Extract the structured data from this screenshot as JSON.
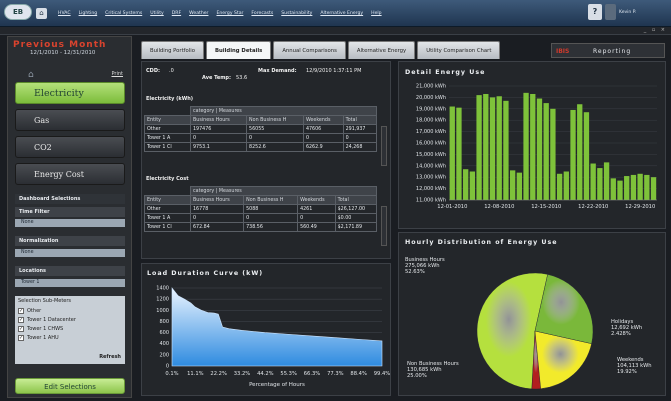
{
  "topbar": {
    "logo": "EB",
    "menu": [
      "HVAC",
      "Lighting",
      "Critical Systems",
      "Utility",
      "DRF",
      "Weather",
      "Energy Star",
      "Forecasts",
      "Sustainability",
      "Alternative Energy",
      "Help"
    ],
    "help_label": "?",
    "user_label": "Kevin P."
  },
  "window": {
    "controls": "_ ▫ ×"
  },
  "left": {
    "title": "Previous Month",
    "dates": "12/1/2010 - 12/31/2010",
    "print": "Print",
    "buttons": [
      {
        "label": "Electricity"
      },
      {
        "label": "Gas"
      },
      {
        "label": "CO2"
      },
      {
        "label": "Energy Cost"
      }
    ],
    "dashboard_selections": "Dashboard Selections",
    "time_filter_label": "Time Filter",
    "time_filter_value": "None",
    "normalization_label": "Normalization",
    "normalization_value": "None",
    "locations_label": "Locations",
    "locations_value": "Tower 1",
    "submeters_title": "Selection Sub-Meters",
    "submeters": [
      {
        "label": "Other"
      },
      {
        "label": "Tower 1 Datacenter"
      },
      {
        "label": "Tower 1 CHWS"
      },
      {
        "label": "Tower 1 AHU"
      }
    ],
    "refresh": "Refresh",
    "edit_selections": "Edit Selections"
  },
  "tabs": [
    {
      "label": "Building Portfolio"
    },
    {
      "label": "Building Details"
    },
    {
      "label": "Annual Comparisons"
    },
    {
      "label": "Alternative Energy"
    },
    {
      "label": "Utility Comparison Chart"
    }
  ],
  "brand": {
    "logo": "IBIS",
    "reporting": "Reporting"
  },
  "details": {
    "cdd_label": "CDD:",
    "cdd_value": ".0",
    "avetemp_label": "Ave Temp:",
    "avetemp_value": "53.6",
    "maxdemand_label": "Max Demand:",
    "maxdemand_value": "12/9/2010 1:37:11 PM",
    "elec_title": "Electricity (kWh)",
    "cost_title": "Electricity Cost",
    "category": "category",
    "measures": "Measures",
    "entity": "Entity",
    "cols": [
      "Business Hours",
      "Non Business H",
      "Weekends",
      "Total"
    ],
    "elec_rows": [
      {
        "name": "Other",
        "c1": "197476",
        "c2": "56055",
        "c3": "47606",
        "c4": "291,937"
      },
      {
        "name": "Tower 1 A",
        "c1": "0",
        "c2": "0",
        "c3": "0",
        "c4": "0"
      },
      {
        "name": "Tower 1 Cl",
        "c1": "9753.1",
        "c2": "8252.6",
        "c3": "6262.9",
        "c4": "24,268"
      }
    ],
    "cost_rows": [
      {
        "name": "Other",
        "c1": "16778",
        "c2": "5088",
        "c3": "4261",
        "c4": "$26,127.00"
      },
      {
        "name": "Tower 1 A",
        "c1": "0",
        "c2": "0",
        "c3": "0",
        "c4": "$0.00"
      },
      {
        "name": "Tower 1 Cl",
        "c1": "672.84",
        "c2": "738.56",
        "c3": "560.49",
        "c4": "$2,171.89"
      }
    ]
  },
  "detail_energy": {
    "title": "Detail Energy Use",
    "chart_data": {
      "type": "bar",
      "ylim": [
        11000,
        21000
      ],
      "yticks": [
        "21,000 kWh",
        "20,000 kWh",
        "19,000 kWh",
        "18,000 kWh",
        "17,000 kWh",
        "16,000 kWh",
        "15,000 kWh",
        "14,000 kWh",
        "13,000 kWh",
        "12,000 kWh",
        "11,000 kWh"
      ],
      "xticks": [
        "12-01-2010",
        "12-08-2010",
        "12-15-2010",
        "12-22-2010",
        "12-29-2010"
      ],
      "values": [
        19200,
        19100,
        13700,
        13500,
        20200,
        20300,
        20000,
        20100,
        19700,
        13600,
        13400,
        20400,
        20300,
        19900,
        19500,
        19000,
        13300,
        13500,
        18900,
        19400,
        18700,
        14200,
        13800,
        14300,
        12900,
        12700,
        13100,
        13200,
        13300,
        13200,
        13000
      ],
      "color": "#7ec23a"
    }
  },
  "load_curve": {
    "title": "Load Duration Curve (kW)",
    "chart_data": {
      "type": "area",
      "xlabel": "Percentage of Hours",
      "ylim": [
        0,
        1400
      ],
      "yticks": [
        "1400",
        "1200",
        "1000",
        "800",
        "600",
        "400",
        "200",
        "0"
      ],
      "xticks": [
        "0.1%",
        "11.1%",
        "22.2%",
        "33.2%",
        "44.2%",
        "55.3%",
        "66.3%",
        "77.3%",
        "88.4%",
        "99.4%"
      ],
      "x": [
        0.1,
        3,
        6,
        9,
        11,
        14,
        17,
        20,
        22,
        24,
        27,
        33,
        44,
        55,
        66,
        77,
        88,
        99.4
      ],
      "y": [
        1400,
        1260,
        1200,
        1130,
        1060,
        1000,
        960,
        950,
        930,
        700,
        670,
        640,
        600,
        570,
        540,
        510,
        480,
        450
      ],
      "color": "#2e8be0"
    }
  },
  "hourly": {
    "title": "Hourly Distribution of Energy Use",
    "chart_data": {
      "type": "pie",
      "series": [
        {
          "name": "Business Hours",
          "value": 275066,
          "value_label": "275,066 kWh",
          "pct_label": "52.63%",
          "color": "#b5e03e"
        },
        {
          "name": "Holidays",
          "value": 12692,
          "value_label": "12,692 kWh",
          "pct_label": "2.428%",
          "color": "#b21f1f"
        },
        {
          "name": "Weekends",
          "value": 104113,
          "value_label": "104,113 kWh",
          "pct_label": "19.92%",
          "color": "#f2ea2b"
        },
        {
          "name": "Non Business Hours",
          "value": 130685,
          "value_label": "130,685 kWh",
          "pct_label": "25.00%",
          "color": "#7ab83a"
        }
      ]
    }
  }
}
